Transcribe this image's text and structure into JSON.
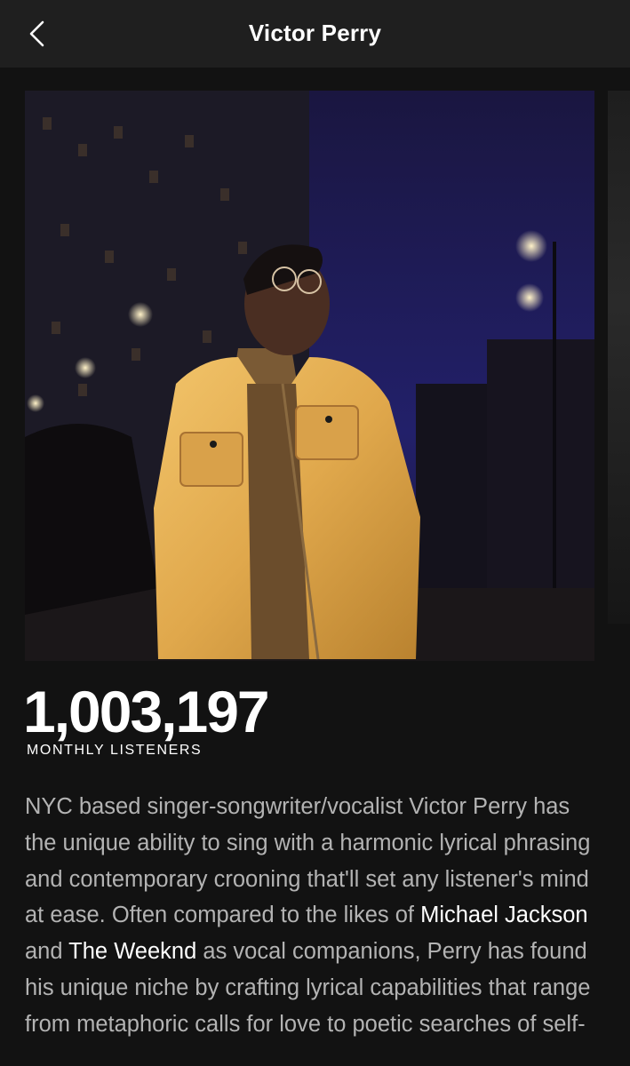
{
  "header": {
    "title": "Victor Perry",
    "back_icon": "chevron-left-icon"
  },
  "artist": {
    "monthly_listeners": "1,003,197",
    "monthly_listeners_label": "MONTHLY LISTENERS"
  },
  "bio": {
    "part1": "NYC based singer-songwriter/vocalist Victor Perry has the unique ability to sing with a harmonic lyrical phrasing and contemporary crooning that'll set any listener's mind at ease. Often compared to the likes of ",
    "link1": "Michael Jackson",
    "part2": " and ",
    "link2": "The Weeknd",
    "part3": " as vocal companions, Perry has found his unique niche by crafting lyrical capabilities that range from metaphoric calls for love to poetic searches of self-"
  },
  "colors": {
    "background": "#121212",
    "header_bg": "#1f1f1f",
    "bio_text": "#b3b3b3",
    "accent_text": "#ffffff"
  }
}
